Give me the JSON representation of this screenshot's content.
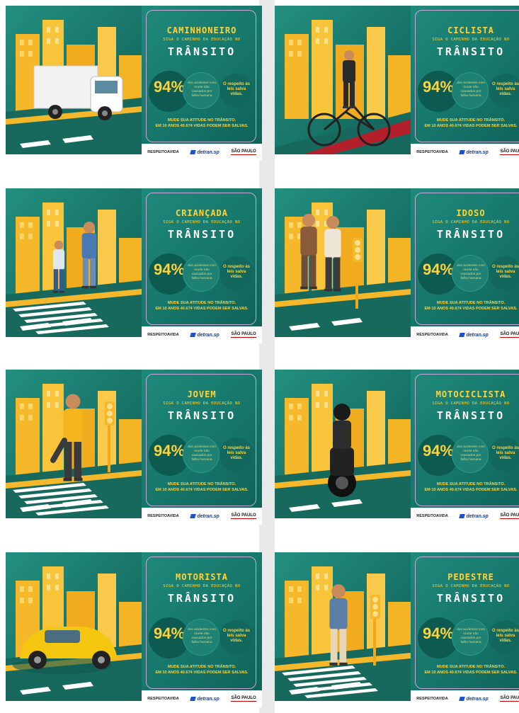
{
  "common": {
    "subtitle": "SIGA O CAMINHO DA EDUCAÇÃO NO",
    "transito": "TRÂNSITO",
    "percent": "94%",
    "acidentes": "dos acidentes com morte são causados por falha humana",
    "respeito": "O respeito às leis salva vidas.",
    "mude_line1": "MUDE SUA ATITUDE NO TRÂNSITO.",
    "mude_line2": "EM 10 ANOS 40.674 VIDAS PODEM SER SALVAS.",
    "logo_respeito": "RESPEITOAVIDA",
    "logo_detran": "detran.sp",
    "logo_sp": "SÃO PAULO"
  },
  "panels": [
    {
      "title": "CAMINHONEIRO",
      "subject": "truck"
    },
    {
      "title": "CICLISTA",
      "subject": "cyclist"
    },
    {
      "title": "CRIANÇADA",
      "subject": "children"
    },
    {
      "title": "IDOSO",
      "subject": "elderly"
    },
    {
      "title": "JOVEM",
      "subject": "youth"
    },
    {
      "title": "MOTOCICLISTA",
      "subject": "motorcycle"
    },
    {
      "title": "MOTORISTA",
      "subject": "car"
    },
    {
      "title": "PEDESTRE",
      "subject": "pedestrian"
    }
  ],
  "colors": {
    "teal": "#1f8a7c",
    "yellow": "#ffd43b",
    "dark_teal": "#0c5a50"
  }
}
